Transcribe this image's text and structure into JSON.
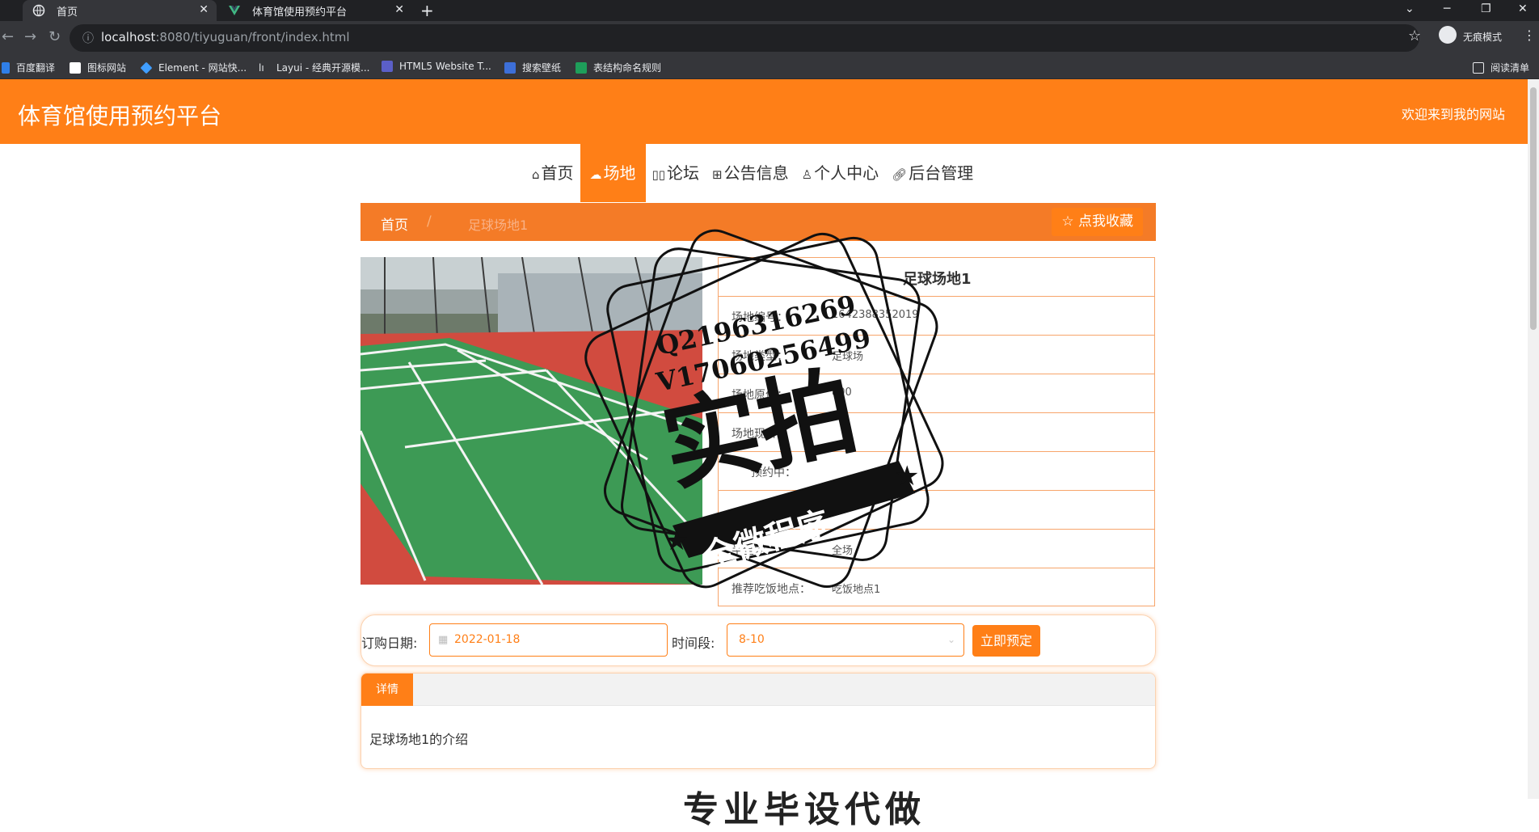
{
  "browser": {
    "tabs": [
      {
        "title": "首页",
        "active": true
      },
      {
        "title": "体育馆使用预约平台",
        "active": false
      }
    ],
    "url_host": "localhost",
    "url_rest": ":8080/tiyuguan/front/index.html",
    "profile_label": "无痕模式",
    "bookmarks": [
      "百度翻译",
      "图标网站",
      "Element - 网站快...",
      "Layui - 经典开源模...",
      "HTML5 Website T...",
      "搜索壁纸",
      "表结构命名规则"
    ],
    "reading_list": "阅读清单"
  },
  "header": {
    "title": "体育馆使用预约平台",
    "welcome": "欢迎来到我的网站"
  },
  "nav": [
    {
      "icon": "home-icon",
      "label": "首页",
      "active": false
    },
    {
      "icon": "cloud-icon",
      "label": "场地",
      "active": true
    },
    {
      "icon": "forum-icon",
      "label": "论坛",
      "active": false
    },
    {
      "icon": "notice-icon",
      "label": "公告信息",
      "active": false
    },
    {
      "icon": "user-icon",
      "label": "个人中心",
      "active": false
    },
    {
      "icon": "link-icon",
      "label": "后台管理",
      "active": false
    }
  ],
  "breadcrumb": {
    "home": "首页",
    "separator": "/",
    "current": "足球场地1",
    "favorite_button": "点我收藏"
  },
  "venue": {
    "title": "足球场地1",
    "rows": [
      {
        "label": "场地编号：",
        "value": "1642388352019"
      },
      {
        "label": "场地类型：",
        "value": "足球场"
      },
      {
        "label": "场地原价：",
        "value": "800"
      },
      {
        "label": "场地现价：",
        "value": ""
      },
      {
        "label": "预约中：",
        "value": ""
      },
      {
        "label": "",
        "value": ""
      },
      {
        "label": "半全场：",
        "value": "全场"
      },
      {
        "label": "推荐吃饭地点：",
        "value": "吃饭地点1"
      }
    ]
  },
  "booking": {
    "date_label": "订购日期:",
    "date_value": "2022-01-18",
    "time_label": "时间段:",
    "time_value": "8-10",
    "submit_label": "立即预定"
  },
  "detail": {
    "tab_label": "详情",
    "text": "足球场地1的介绍"
  },
  "bottom_heading": "专业毕设代做",
  "watermark": {
    "line1": "Q2196316269",
    "line2": "V17060256499",
    "main": "实拍",
    "ribbon": "全微程序"
  },
  "colors": {
    "accent": "#ff7f17",
    "breadcrumb_bg": "#f47b27",
    "chrome_dark": "#202124",
    "chrome_mid": "#35363a"
  }
}
